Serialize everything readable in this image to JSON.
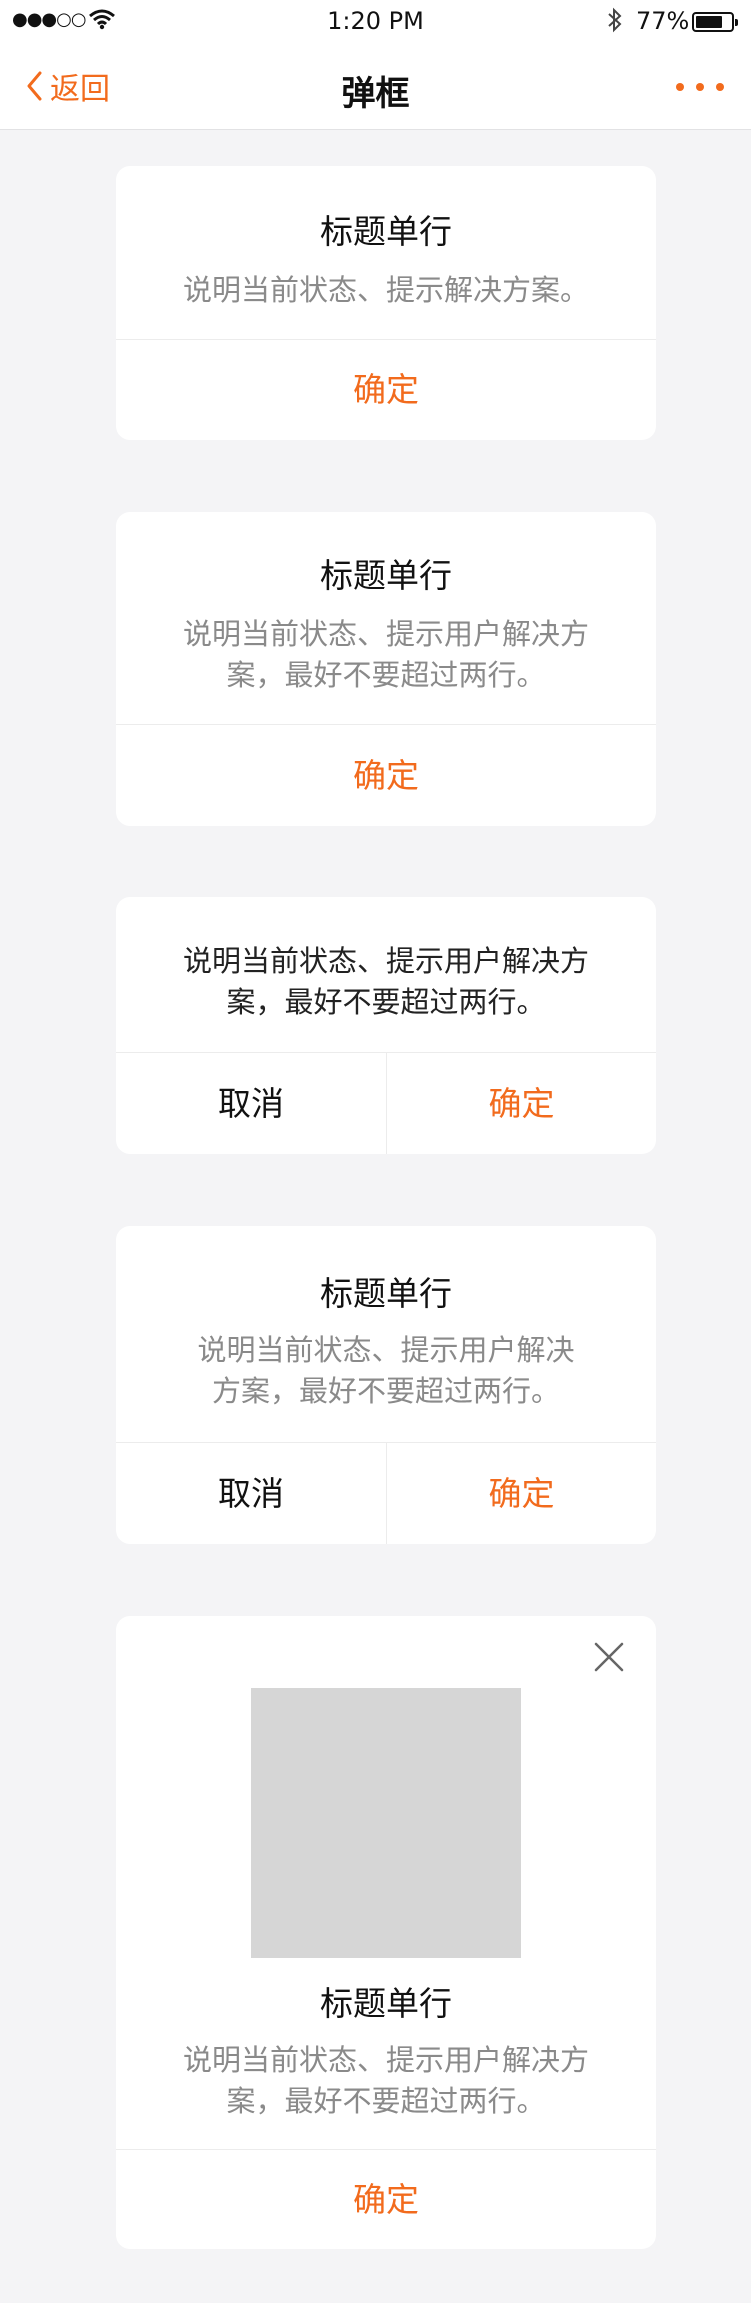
{
  "status_bar": {
    "signal": "●●●○○",
    "time": "1:20 PM",
    "battery_percent": "77%",
    "battery_level": 0.77
  },
  "nav": {
    "back_label": "返回",
    "title": "弹框",
    "accent_color": "#f26b1d"
  },
  "dialogs": [
    {
      "title": "标题单行",
      "description": "说明当前状态、提示解决方案。",
      "confirm_label": "确定"
    },
    {
      "title": "标题单行",
      "description_line1": "说明当前状态、提示用户解决方",
      "description_line2": "案，最好不要超过两行。",
      "confirm_label": "确定"
    },
    {
      "description_line1": "说明当前状态、提示用户解决方",
      "description_line2": "案，最好不要超过两行。",
      "cancel_label": "取消",
      "confirm_label": "确定"
    },
    {
      "title": "标题单行",
      "description_line1": "说明当前状态、提示用户解决",
      "description_line2": "方案，最好不要超过两行。",
      "cancel_label": "取消",
      "confirm_label": "确定"
    },
    {
      "title": "标题单行",
      "description_line1": "说明当前状态、提示用户解决方",
      "description_line2": "案，最好不要超过两行。",
      "confirm_label": "确定",
      "close_icon": "close-icon"
    }
  ]
}
